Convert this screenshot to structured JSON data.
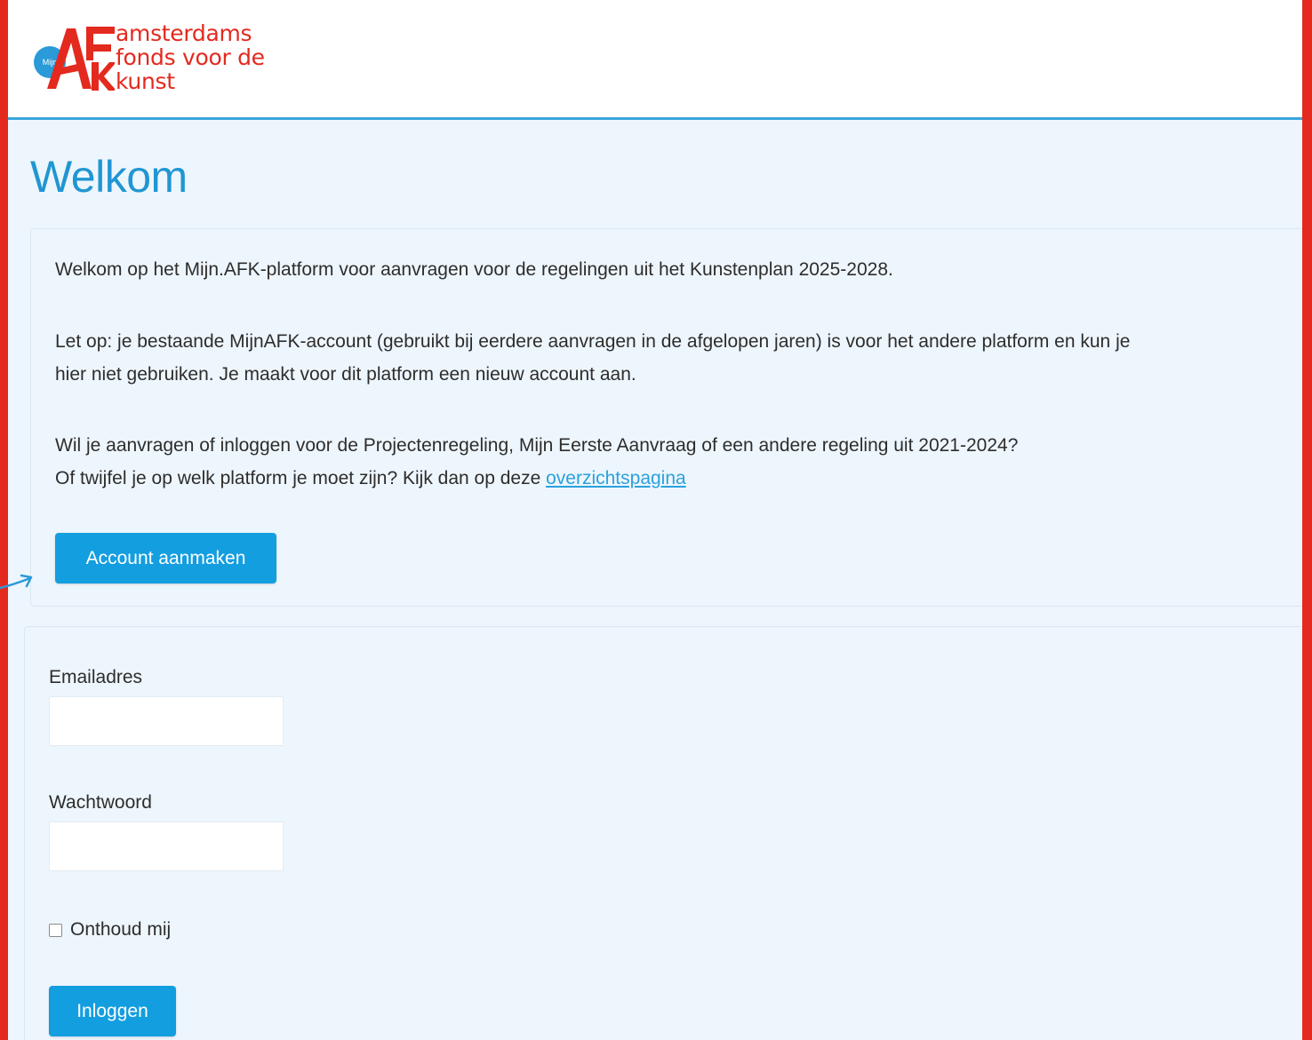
{
  "colors": {
    "brand_red": "#e4291e",
    "accent_blue": "#139ee0",
    "title_blue": "#2096d3",
    "background": "#eef6fd"
  },
  "logo": {
    "badge_text": "Mijn",
    "mark_letters": "AFK",
    "lines": [
      "amsterdams",
      "fonds voor de",
      "kunst"
    ]
  },
  "page": {
    "title": "Welkom"
  },
  "intro": {
    "paragraph_1": "Welkom op het Mijn.AFK-platform voor aanvragen voor de regelingen uit het Kunstenplan 2025-2028.",
    "paragraph_2_line_1": "Let op: je bestaande MijnAFK-account (gebruikt bij eerdere aanvragen in de afgelopen jaren) is voor het andere platform en kun je",
    "paragraph_2_line_2": "hier niet gebruiken. Je maakt voor dit platform een nieuw account aan.",
    "paragraph_3_line_1": "Wil je aanvragen of inloggen voor de Projectenregeling, Mijn Eerste Aanvraag of een andere regeling uit 2021-2024?",
    "paragraph_3_line_2": "Of twijfel je op welk platform je moet zijn? Kijk dan op deze",
    "link_text": "overzichtspagina",
    "create_account_button": "Account aanmaken"
  },
  "login": {
    "email_label": "Emailadres",
    "email_value": "",
    "password_label": "Wachtwoord",
    "password_value": "",
    "remember_label": "Onthoud mij",
    "remember_checked": false,
    "submit_button": "Inloggen"
  },
  "icons": {
    "side_arrow": "arrow-right-icon",
    "checkbox": "checkbox-icon"
  }
}
